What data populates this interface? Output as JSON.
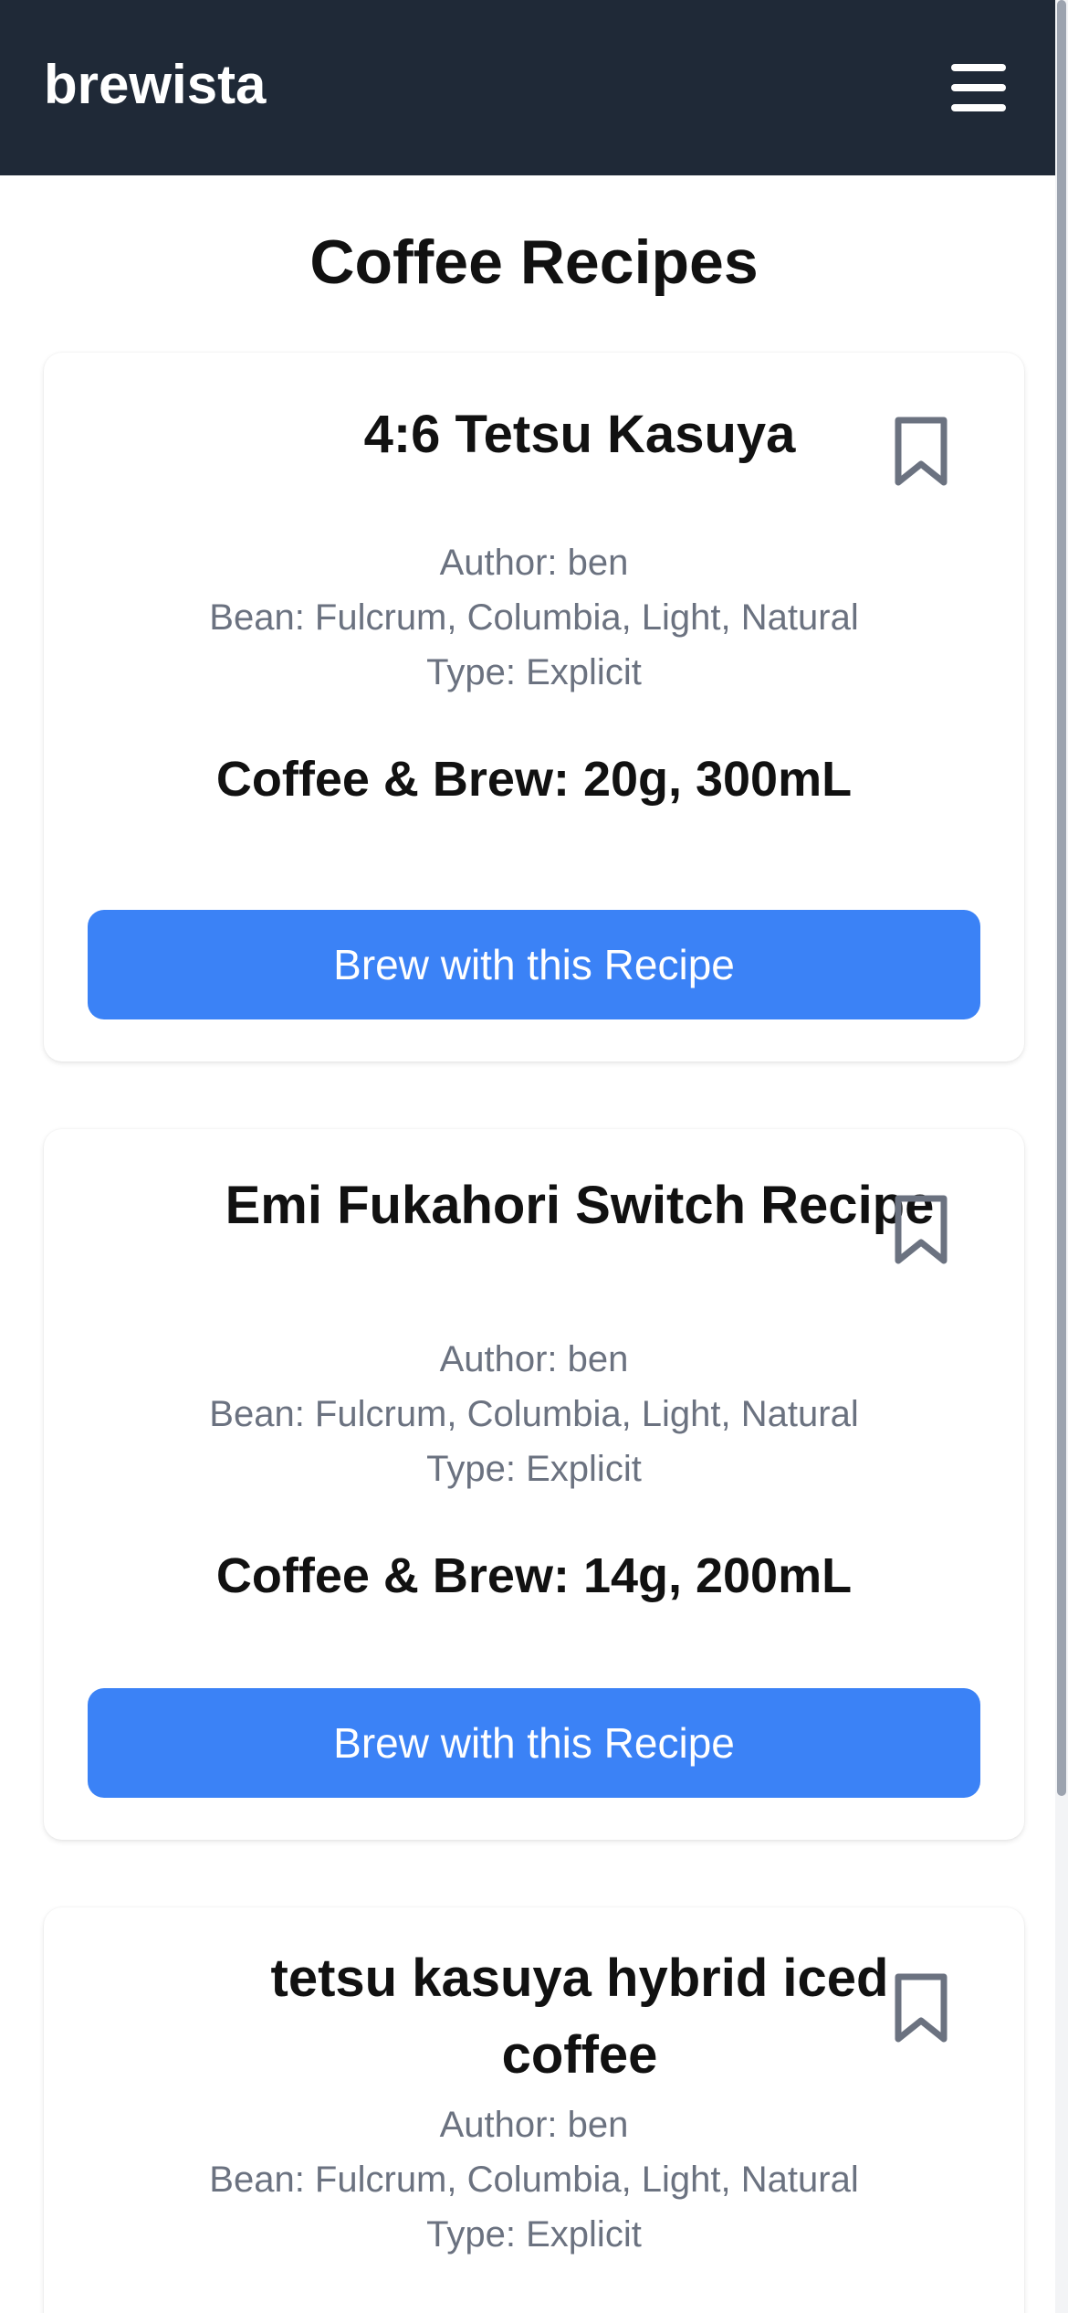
{
  "header": {
    "brand": "brewista",
    "menu_icon": "hamburger-menu-icon"
  },
  "main": {
    "title": "Coffee Recipes",
    "recipes": [
      {
        "name": "4:6 Tetsu Kasuya",
        "author": "Author: ben",
        "bean": "Bean: Fulcrum, Columbia, Light, Natural",
        "type": "Type: Explicit",
        "summary": "Coffee & Brew: 20g, 300mL",
        "button_label": "Brew with this Recipe",
        "bookmark_icon": "bookmark-icon"
      },
      {
        "name": "Emi Fukahori Switch Recipe",
        "author": "Author: ben",
        "bean": "Bean: Fulcrum, Columbia, Light, Natural",
        "type": "Type: Explicit",
        "summary": "Coffee & Brew: 14g, 200mL",
        "button_label": "Brew with this Recipe",
        "bookmark_icon": "bookmark-icon"
      },
      {
        "name": "tetsu kasuya hybrid iced coffee",
        "author": "Author: ben",
        "bean": "Bean: Fulcrum, Columbia, Light, Natural",
        "type": "Type: Explicit",
        "bookmark_icon": "bookmark-icon"
      }
    ]
  },
  "colors": {
    "navbar": "#1f2937",
    "accent": "#3b82f6",
    "meta_text": "#6b7280",
    "bookmark": "#6b7280"
  }
}
